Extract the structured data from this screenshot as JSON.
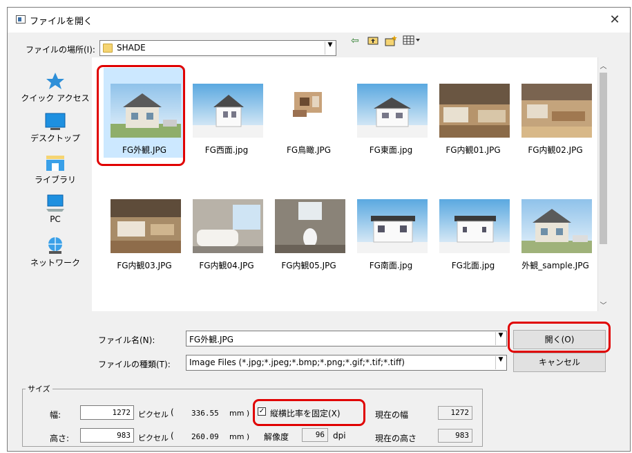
{
  "window": {
    "title": "ファイルを開く",
    "close_glyph": "✕"
  },
  "location": {
    "label": "ファイルの場所(I):",
    "value": "SHADE"
  },
  "places": [
    {
      "label": "クイック アクセス",
      "icon": "star-icon"
    },
    {
      "label": "デスクトップ",
      "icon": "desktop-icon"
    },
    {
      "label": "ライブラリ",
      "icon": "library-icon"
    },
    {
      "label": "PC",
      "icon": "pc-icon"
    },
    {
      "label": "ネットワーク",
      "icon": "network-icon"
    }
  ],
  "files": [
    {
      "name": "FG外観.JPG",
      "selected": true,
      "kind": "exterior"
    },
    {
      "name": "FG西面.jpg",
      "kind": "elevation"
    },
    {
      "name": "FG鳥瞰.JPG",
      "kind": "plan"
    },
    {
      "name": "FG東面.jpg",
      "kind": "elevation"
    },
    {
      "name": "FG内観01.JPG",
      "kind": "interior"
    },
    {
      "name": "FG内観02.JPG",
      "kind": "interior"
    },
    {
      "name": "FG内観03.JPG",
      "kind": "interior"
    },
    {
      "name": "FG内観04.JPG",
      "kind": "bath"
    },
    {
      "name": "FG内観05.JPG",
      "kind": "toilet"
    },
    {
      "name": "FG南面.jpg",
      "kind": "elevation"
    },
    {
      "name": "FG北面.jpg",
      "kind": "elevation"
    },
    {
      "name": "外観_sample.JPG",
      "kind": "exterior"
    }
  ],
  "filename": {
    "label": "ファイル名(N):",
    "value": "FG外観.JPG"
  },
  "filetype": {
    "label": "ファイルの種類(T):",
    "value": "Image Files (*.jpg;*.jpeg;*.bmp;*.png;*.gif;*.tif;*.tiff)"
  },
  "buttons": {
    "open": "開く(O)",
    "cancel": "キャンセル"
  },
  "size": {
    "title": "サイズ",
    "width_label": "幅:",
    "height_label": "高さ:",
    "width_px": "1272",
    "height_px": "983",
    "pixel_unit": "ピクセル",
    "open_paren": "(",
    "width_mm": "336.55",
    "height_mm": "260.09",
    "mm_unit": "mm )",
    "aspect_label": "縦横比率を固定(X)",
    "aspect_checked": true,
    "resolution_label": "解像度",
    "resolution_value": "96",
    "dpi_unit": "dpi",
    "current_width_label": "現在の幅",
    "current_width_value": "1272",
    "current_height_label": "現在の高さ",
    "current_height_value": "983"
  },
  "colors": {
    "highlight": "#e00000",
    "selection": "#cce8ff"
  }
}
